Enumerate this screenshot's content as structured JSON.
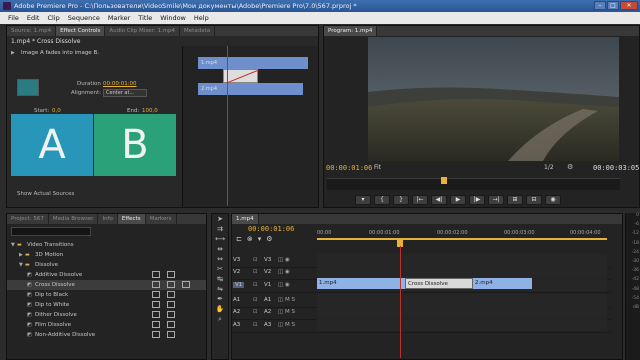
{
  "window": {
    "title": "Adobe Premiere Pro - C:\\Пользователи\\VideoSmile\\Мои документы\\Adobe\\Premiere Pro\\7.0\\567.prproj *",
    "controls": [
      "–",
      "□",
      "✕"
    ]
  },
  "menu": [
    "File",
    "Edit",
    "Clip",
    "Sequence",
    "Marker",
    "Title",
    "Window",
    "Help"
  ],
  "effect_controls": {
    "tabs": [
      "Source: 1.mp4",
      "Effect Controls",
      "Audio Clip Mixer: 1.mp4",
      "Metadata"
    ],
    "clip_title": "1.mp4 * Cross Dissolve",
    "description": "Image A fades into image B.",
    "duration_label": "Duration",
    "duration_value": "00:00:01:00",
    "alignment_label": "Alignment:",
    "alignment_value": "Center at...",
    "start_label": "Start:",
    "start_value": "0,0",
    "end_label": "End:",
    "end_value": "100,0",
    "a_letter": "A",
    "b_letter": "B",
    "show_sources": "Show Actual Sources",
    "mini_clip_a": "1.mp4",
    "mini_clip_b": "2.mp4",
    "timecode": "00:00:01:06"
  },
  "program": {
    "tab": "Program: 1.mp4",
    "timecode_current": "00:00:01:06",
    "fit": "Fit",
    "resolution": "1/2",
    "timecode_total": "00:00:03:05",
    "controls": [
      "▾",
      "{",
      "}",
      "|←",
      "◀|",
      "▶",
      "|▶",
      "→|",
      "⊞",
      "⊟",
      "◉"
    ]
  },
  "effects": {
    "tabs": [
      "Project: 567",
      "Media Browser",
      "Info",
      "Effects",
      "Markers"
    ],
    "items": [
      {
        "label": "Video Transitions",
        "indent": 1
      },
      {
        "label": "3D Motion",
        "indent": 2
      },
      {
        "label": "Dissolve",
        "indent": 2
      },
      {
        "label": "Additive Dissolve",
        "indent": 3
      },
      {
        "label": "Cross Dissolve",
        "indent": 3
      },
      {
        "label": "Dip to Black",
        "indent": 3
      },
      {
        "label": "Dip to White",
        "indent": 3
      },
      {
        "label": "Dither Dissolve",
        "indent": 3
      },
      {
        "label": "Film Dissolve",
        "indent": 3
      },
      {
        "label": "Non-Additive Dissolve",
        "indent": 3
      }
    ]
  },
  "timeline": {
    "tab": "1.mp4",
    "timecode": "00:00:01:06",
    "ruler": [
      "00:00",
      "00:00:01:00",
      "00:00:02:00",
      "00:00:03:00",
      "00:00:04:00"
    ],
    "tracks": [
      {
        "lock": "V3",
        "name": "V3"
      },
      {
        "lock": "V2",
        "name": "V2"
      },
      {
        "lock": "V1",
        "name": "V1"
      },
      {
        "lock": "A1",
        "name": "A1"
      },
      {
        "lock": "A2",
        "name": "A2"
      },
      {
        "lock": "A3",
        "name": "A3"
      }
    ],
    "clip_1": "1.mp4",
    "transition": "Cross Dissolve",
    "clip_2": "2.mp4"
  },
  "meter_labels": [
    "0",
    "-6",
    "-12",
    "-18",
    "-24",
    "-30",
    "-36",
    "-42",
    "-48",
    "-54",
    "dB",
    "",
    "",
    ""
  ]
}
